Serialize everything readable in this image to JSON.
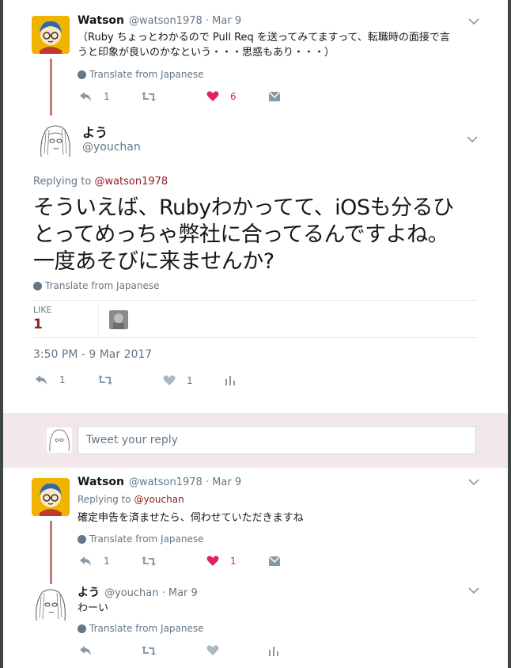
{
  "tweet1": {
    "name": "Watson",
    "handle": "@watson1978 · Mar 9",
    "text_line1": "（Ruby ちょっとわかるので Pull Req を送ってみてますって、転職時の面接で言",
    "text_line2": "うと印象が良いのかなという・・・思惑もあり・・・）",
    "translate": "Translate from Japanese",
    "reply_count": "1",
    "like_count": "6"
  },
  "main": {
    "name": "よう",
    "handle": "@youchan",
    "replying_prefix": "Replying to",
    "replying_user": "@watson1978",
    "text_line1": "そういえば、Rubyわかってて、iOSも分るひ",
    "text_line2": "とってめっちゃ弊社に合ってるんですよね。",
    "text_line3": "一度あそびに来ませんか?",
    "translate": "Translate from Japanese",
    "like_label": "LIKE",
    "like_stat": "1",
    "timestamp": "3:50 PM - 9 Mar 2017",
    "reply_count": "1",
    "like_count": "1"
  },
  "composer": {
    "placeholder": "Tweet your reply"
  },
  "tweet3": {
    "name": "Watson",
    "handle": "@watson1978 · Mar 9",
    "replying_prefix": "Replying to",
    "replying_user": "@youchan",
    "text": "確定申告を済ませたら、伺わせていただきますね",
    "translate": "Translate from Japanese",
    "reply_count": "1",
    "like_count": "1"
  },
  "tweet4": {
    "name": "よう",
    "handle": "@youchan · Mar 9",
    "text": "わーい",
    "translate": "Translate from Japanese"
  },
  "colors": {
    "like_active": "#e0245e",
    "link": "#8f1f24",
    "reply_band": "#f3e8e9",
    "thread_line": "#c6787f"
  }
}
